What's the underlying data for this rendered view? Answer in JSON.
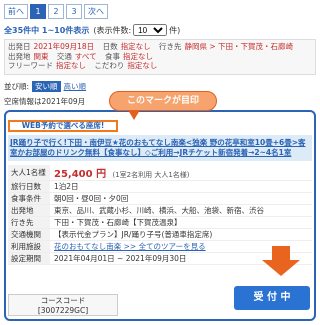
{
  "pager": {
    "prev_label": "前へ",
    "pages": [
      "1",
      "2",
      "3"
    ],
    "active_page": "1",
    "next_label": "次へ"
  },
  "results": {
    "total_label": "全35件中 1~10件表示",
    "display_prefix": "(表示件数:",
    "display_value": "10",
    "display_suffix": "件)"
  },
  "conditions": {
    "line1": [
      {
        "k": "出発日",
        "v": "2021年09月18日"
      },
      {
        "k": "日数",
        "v": "指定なし"
      },
      {
        "k": "行き先",
        "v": "静岡県 > 下田・下賀茂・石廊崎"
      }
    ],
    "line2": [
      {
        "k": "出発地",
        "v": "関東"
      },
      {
        "k": "交通",
        "v": "すべて"
      },
      {
        "k": "食事",
        "v": "指定なし"
      }
    ],
    "line3": [
      {
        "k": "フリーワード",
        "v": "指定なし"
      },
      {
        "k": "こだわり",
        "v": "指定なし"
      }
    ]
  },
  "sort": {
    "label": "並び順:",
    "option_cheap": "安い順",
    "option_expensive": "高い順"
  },
  "vacancy_text": "空席情報は2021年09月",
  "callout_text": "このマークが目印",
  "tour": {
    "web_tag": "WEB予約で選べる座席!",
    "title": "JR踊り子で行く!下田・南伊豆★花のおもてなし南楽<独楽 野の花亭和室10畳+6畳>客室かお部屋のドリンク無料【食事なし】◇ご利用→JRチケット新宿発着→2~4名1室",
    "rows": [
      {
        "label": "大人1名様",
        "price": "25,400 円",
        "sub": "(1室2名利用 大人1名様)"
      },
      {
        "label": "旅行日数",
        "value": "1泊2日"
      },
      {
        "label": "食事条件",
        "value": "朝0回・昼0回・夕0回"
      },
      {
        "label": "出発地",
        "value": "東京、品川、武蔵小杉、川崎、横浜、大船、池袋、新宿、渋谷"
      },
      {
        "label": "行き先",
        "value": "下田・下賀茂・石廊崎【下賀茂温泉】"
      },
      {
        "label": "交通機関",
        "value": "【表示代金プラン】JR/踊り子号(普通車指定席)"
      },
      {
        "label": "利用施設",
        "value": "花のおもてなし南楽 >> 全てのツアーを見る"
      },
      {
        "label": "設定期間",
        "value": "2021年04月01日 ~ 2021年09月30日"
      }
    ],
    "course_label": "コースコード",
    "course_code": "[3007229GC]",
    "accept_label": "受 付 中"
  }
}
